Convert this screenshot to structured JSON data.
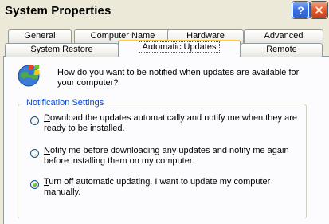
{
  "window": {
    "title": "System Properties",
    "help_label": "?",
    "close_label": "✕"
  },
  "tabs": {
    "row1": [
      "General",
      "Computer Name",
      "Hardware",
      "Advanced"
    ],
    "row2": [
      "System Restore",
      "Automatic Updates",
      "Remote"
    ],
    "active": "Automatic Updates"
  },
  "question": "How do you want to be notified when updates are available for your computer?",
  "notification": {
    "legend": "Notification Settings",
    "options": [
      {
        "accel": "D",
        "text": "ownload the updates automatically and notify me when they are ready to be installed.",
        "checked": false
      },
      {
        "accel": "N",
        "text": "otify me before downloading any updates and notify me again before installing them on my computer.",
        "checked": false
      },
      {
        "accel": "T",
        "text": "urn off automatic updating. I want to update my computer manually.",
        "checked": true
      }
    ]
  },
  "icons": {
    "header": "windows-update-globe-icon"
  }
}
